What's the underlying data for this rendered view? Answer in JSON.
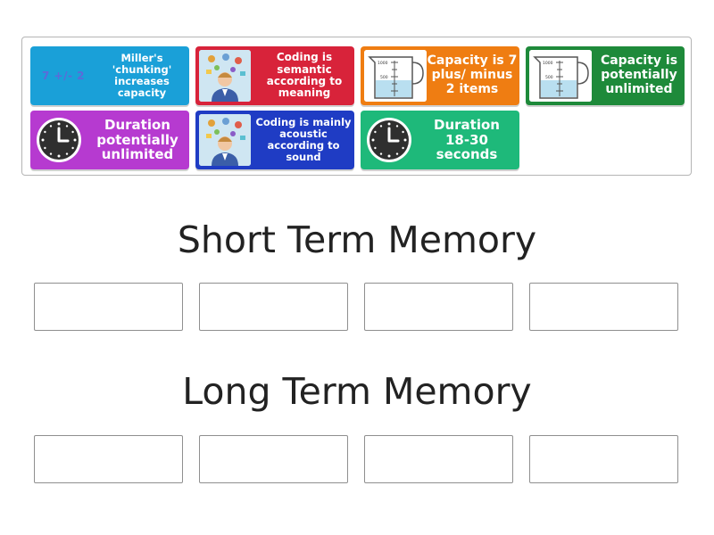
{
  "cards": [
    {
      "id": "millers-chunking",
      "text": "Miller's 'chunking' increases capacity",
      "formula": "7 +/- 2",
      "color": "#1aa0d8",
      "icon": "formula"
    },
    {
      "id": "coding-semantic",
      "text": "Coding is semantic according to meaning",
      "color": "#d8233a",
      "icon": "thinking-person-icon"
    },
    {
      "id": "capacity-7",
      "text": "Capacity is 7 plus/ minus 2 items",
      "color": "#ef7d12",
      "icon": "beaker-icon"
    },
    {
      "id": "capacity-unlimited",
      "text": "Capacity is potentially unlimited",
      "color": "#1e8a3a",
      "icon": "beaker-icon"
    },
    {
      "id": "duration-unlimited",
      "text": "Duration potentially unlimited",
      "color": "#b63ad0",
      "icon": "clock-icon"
    },
    {
      "id": "coding-acoustic",
      "text": "Coding is mainly acoustic according to sound",
      "color": "#1f3cc4",
      "icon": "thinking-person-icon"
    },
    {
      "id": "duration-18-30",
      "text": "Duration 18-30 seconds",
      "color": "#1eb97a",
      "icon": "clock-icon"
    }
  ],
  "groups": [
    {
      "title": "Short Term Memory",
      "slots": 4
    },
    {
      "title": "Long Term Memory",
      "slots": 4
    }
  ],
  "beaker": {
    "top_tick": "1000",
    "mid_tick": "500"
  }
}
